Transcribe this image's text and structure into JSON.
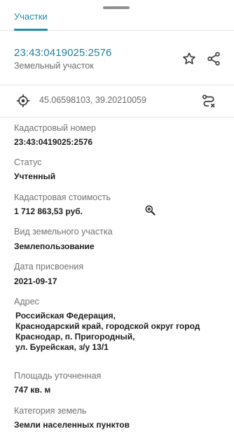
{
  "tabs": {
    "active_label": "Участки"
  },
  "header": {
    "cadastral_id": "23:43:0419025:2576",
    "type": "Земельный участок",
    "star_icon": "star-outline-icon",
    "share_icon": "share-icon"
  },
  "coordinates": {
    "text": "45.06598103, 39.20210059",
    "locate_icon": "crosshair-target-icon",
    "route_icon": "route-icon"
  },
  "fields": {
    "cadastral_number_label": "Кадастровый номер",
    "cadastral_number_value": "23:43:0419025:2576",
    "status_label": "Статус",
    "status_value": "Учтенный",
    "cost_label": "Кадастровая стоимость",
    "cost_value": "1 712 863,53 руб.",
    "land_type_label": "Вид земельного участка",
    "land_type_value": "Землепользование",
    "date_label": "Дата присвоения",
    "date_value": "2021-09-17",
    "address_label": "Адрес",
    "address_lines": [
      "Российская Федерация,",
      "Краснодарский край, городской округ город",
      "Краснодар, п. Пригородный,",
      "ул. Бурейская, з/у 13/1"
    ],
    "area_label": "Площадь уточненная",
    "area_value": "747 кв. м",
    "category_label": "Категория земель",
    "category_value": "Земли населенных пунктов"
  },
  "colors": {
    "accent": "#1f8fa6",
    "link": "#1f7fa0",
    "label": "#727272",
    "divider": "#e6e6e6"
  }
}
